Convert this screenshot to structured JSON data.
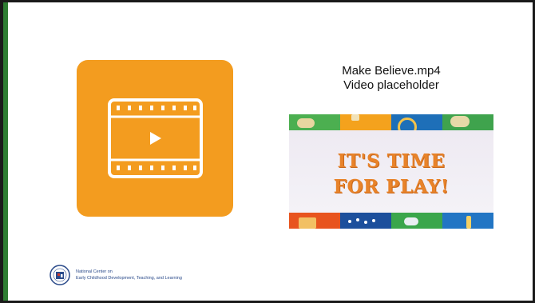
{
  "caption": {
    "filename": "Make Believe.mp4",
    "subtitle": "Video placeholder"
  },
  "thumbnail": {
    "title_line1": "IT'S TIME",
    "title_line2": "FOR PLAY!"
  },
  "logo": {
    "line1": "National Center on",
    "line2": "Early Childhood Development, Teaching, and Learning"
  },
  "colors": {
    "accent_bar": "#2e7d32",
    "video_tile": "#f39c1f",
    "thumb_title": "#e8832a"
  },
  "icons": {
    "video": "video-film-play-icon",
    "logo": "seal-logo-icon"
  }
}
